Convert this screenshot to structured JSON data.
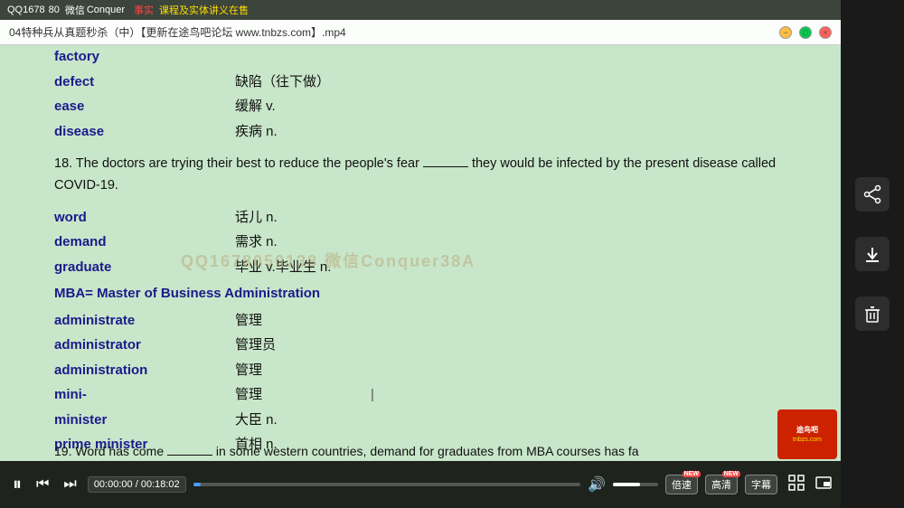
{
  "window": {
    "title": "04特种兵从真题秒杀（中）【更新在途鸟吧论坛 www.tnbzs.com】.mp4"
  },
  "watermark_top": {
    "qq": "QQ1678",
    "wx_label": "微信",
    "wx_id": "Conquer",
    "red_text": "事实",
    "yellow_text": "课程及实体讲义在售"
  },
  "vocabulary": [
    {
      "en": "factory",
      "zh": "",
      "pos": ""
    },
    {
      "en": "defect",
      "zh": "缺陷（往下做）",
      "pos": ""
    },
    {
      "en": "ease",
      "zh": "缓解 v.",
      "pos": ""
    },
    {
      "en": "disease",
      "zh": "疾病 n.",
      "pos": ""
    }
  ],
  "sentence1": "18. The doctors are trying their best to reduce the people's fear ______ they would be infected by the present disease called COVID-19.",
  "vocabulary2": [
    {
      "en": "word",
      "zh": "话儿 n.",
      "pos": ""
    },
    {
      "en": "demand",
      "zh": "需求 n.",
      "pos": ""
    },
    {
      "en": "graduate",
      "zh": "毕业 v.毕业生 n.",
      "pos": ""
    }
  ],
  "mba_line": "MBA= Master of Business Administration",
  "vocabulary3": [
    {
      "en": "administrate",
      "zh": "管理",
      "pos": ""
    },
    {
      "en": "administrator",
      "zh": "管理员",
      "pos": ""
    },
    {
      "en": "administration",
      "zh": "管理",
      "pos": ""
    },
    {
      "en": "mini-",
      "zh": "管理",
      "pos": ""
    },
    {
      "en": "minister",
      "zh": "大臣 n.",
      "pos": ""
    },
    {
      "en": "prime minister",
      "zh": "首相 n.",
      "pos": ""
    }
  ],
  "sentence2": "19. Word has come ______ in some western countries, demand for graduates from MBA courses has fa",
  "center_watermark": "QQ1678050138  微信Conquer38A",
  "controls": {
    "play_icon": "⏸",
    "prev_icon": "⏮",
    "next_icon": "⏭",
    "time_current": "00:00:00",
    "time_total": "00:18:02",
    "volume_icon": "🔊",
    "speed_label": "倍速",
    "quality_label": "高清",
    "subtitle_label": "字幕",
    "fullscreen_icon": "⛶"
  },
  "sidebar_icons": {
    "share": "⑆",
    "download": "↓",
    "delete": "🗑"
  }
}
